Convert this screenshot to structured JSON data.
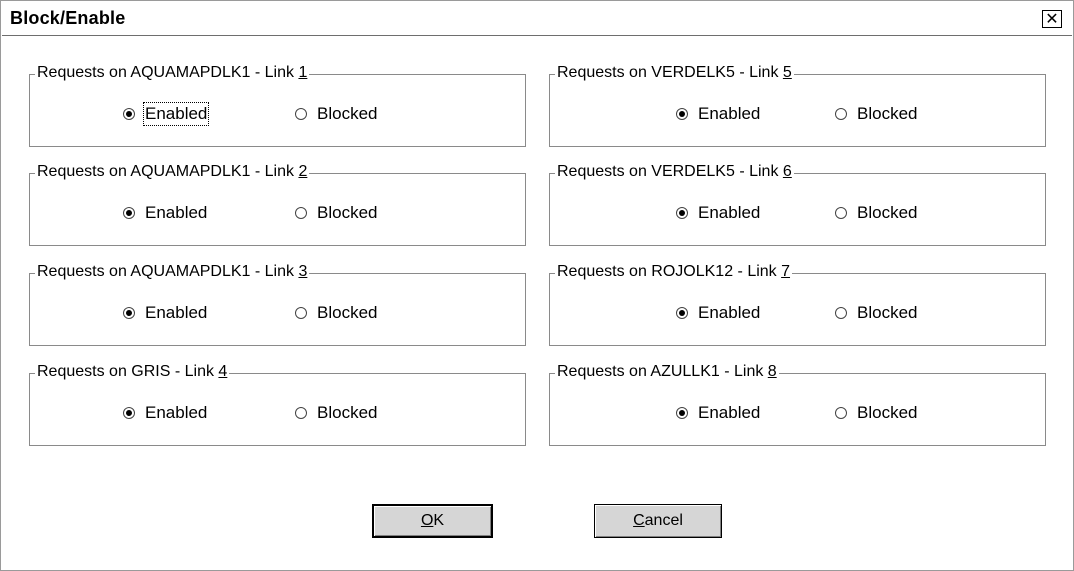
{
  "window": {
    "title": "Block/Enable",
    "close_glyph": "✕"
  },
  "groups": [
    {
      "prefix": "Requests on AQUAMAPDLK1 - Link ",
      "num": "1",
      "enabled": "Enabled",
      "blocked": "Blocked",
      "selected": "enabled"
    },
    {
      "prefix": "Requests on VERDELK5 - Link ",
      "num": "5",
      "enabled": "Enabled",
      "blocked": "Blocked",
      "selected": "enabled"
    },
    {
      "prefix": "Requests on AQUAMAPDLK1 - Link ",
      "num": "2",
      "enabled": "Enabled",
      "blocked": "Blocked",
      "selected": "enabled"
    },
    {
      "prefix": "Requests on VERDELK5 - Link ",
      "num": "6",
      "enabled": "Enabled",
      "blocked": "Blocked",
      "selected": "enabled"
    },
    {
      "prefix": "Requests on AQUAMAPDLK1 - Link ",
      "num": "3",
      "enabled": "Enabled",
      "blocked": "Blocked",
      "selected": "enabled"
    },
    {
      "prefix": "Requests on ROJOLK12 - Link ",
      "num": "7",
      "enabled": "Enabled",
      "blocked": "Blocked",
      "selected": "enabled"
    },
    {
      "prefix": "Requests on GRIS - Link ",
      "num": "4",
      "enabled": "Enabled",
      "blocked": "Blocked",
      "selected": "enabled"
    },
    {
      "prefix": "Requests on AZULLK1 - Link ",
      "num": "8",
      "enabled": "Enabled",
      "blocked": "Blocked",
      "selected": "enabled"
    }
  ],
  "buttons": {
    "ok": {
      "mnemonic": "O",
      "rest": "K"
    },
    "cancel": {
      "mnemonic": "C",
      "rest": "ancel"
    }
  }
}
